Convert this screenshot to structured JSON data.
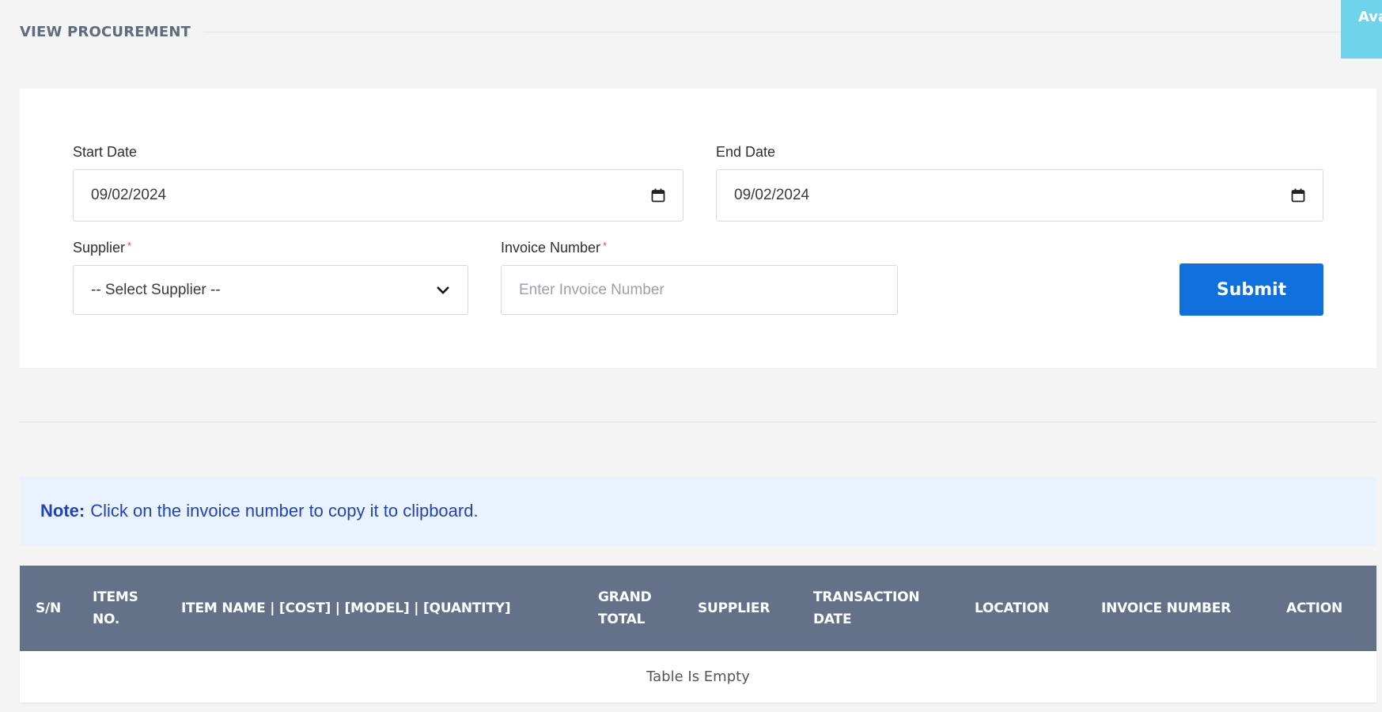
{
  "header": {
    "title": "VIEW PROCUREMENT",
    "corner_tab_text": "Ava Re"
  },
  "filters": {
    "start_date": {
      "label": "Start Date",
      "value": "09/02/2024",
      "icon": "calendar-icon"
    },
    "end_date": {
      "label": "End Date",
      "value": "09/02/2024",
      "icon": "calendar-icon"
    },
    "supplier": {
      "label": "Supplier",
      "required_mark": "*",
      "selected": "-- Select Supplier --",
      "icon": "chevron-down-icon"
    },
    "invoice_number": {
      "label": "Invoice Number",
      "required_mark": "*",
      "placeholder": "Enter Invoice Number",
      "value": ""
    },
    "submit_label": "Submit"
  },
  "note": {
    "strong": "Note:",
    "text": "Click on the invoice number to copy it to clipboard."
  },
  "table": {
    "columns": [
      "S/N",
      "ITEMS NO.",
      "ITEM NAME | [COST] | [MODEL] | [QUANTITY]",
      "GRAND TOTAL",
      "SUPPLIER",
      "TRANSACTION DATE",
      "LOCATION",
      "INVOICE NUMBER",
      "ACTION"
    ],
    "empty_message": "Table Is Empty"
  },
  "colors": {
    "background": "#f4f4f5",
    "primary_button": "#0f6fdc",
    "table_header": "#637288",
    "note_bg": "#eaf3fd",
    "note_text": "#1f45b5",
    "required": "#e04848",
    "corner_tab": "#6fd3ec"
  }
}
